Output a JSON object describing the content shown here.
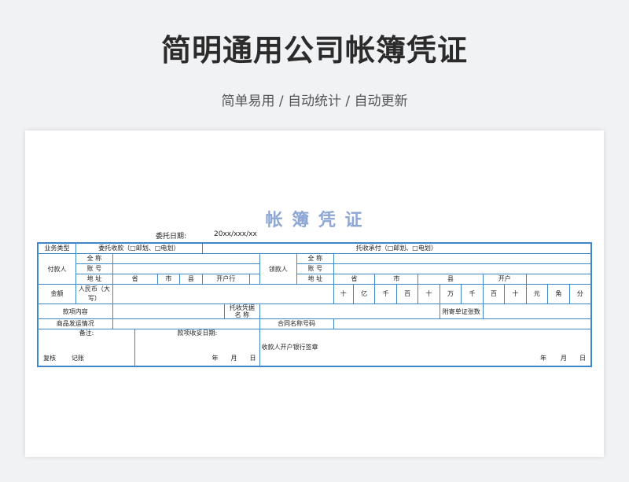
{
  "header": {
    "title": "简明通用公司帐簿凭证",
    "subtitle": "简单易用 / 自动统计 / 自动更新"
  },
  "form": {
    "title": "帐 簿 凭 证",
    "date_label": "委托日期:",
    "date_value": "20xx/xxx/xx",
    "business_type_label": "业务类型",
    "collection_option": "委托收款（□邮划、□电划）",
    "acceptance_option": "托收承付（□邮划、□电划）",
    "payer_label": "付款人",
    "payee_label": "领款人",
    "full_name": "全 称",
    "account_no": "账 号",
    "address": "地 址",
    "province": "省",
    "city": "市",
    "county": "县",
    "bank": "开户行",
    "bank_short": "开户",
    "amount_label": "金额",
    "rmb_label": "人民币（大写）",
    "digits": [
      "十",
      "亿",
      "千",
      "百",
      "十",
      "万",
      "千",
      "百",
      "十",
      "元",
      "角",
      "分"
    ],
    "fund_content": "款项内容",
    "collection_doc_name": "托收凭据名 称",
    "attached_docs": "附寄单证张数",
    "goods_shipping": "商品发运情况",
    "contract_no": "合同名称号码",
    "remarks": "备注:",
    "receive_date": "款项收妥日期:",
    "payee_bank_sign": "收款人开户银行签章",
    "review": "复核",
    "bookkeep": "记账",
    "year": "年",
    "month": "月",
    "day": "日"
  }
}
